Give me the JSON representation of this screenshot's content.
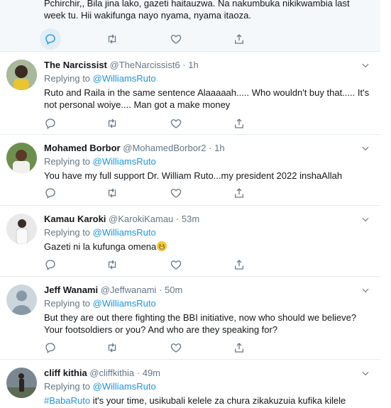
{
  "tweets": [
    {
      "text": "Pchirchir,, Bila jina lako, gazeti haitauzwa. Na nakumbuka nikikwambia last week tu. Hii wakifunga nayo nyama, nyama itaoza."
    },
    {
      "name": "The Narcissist",
      "handle": "@TheNarcissist6",
      "dot": "·",
      "time": "1h",
      "replying_prefix": "Replying to",
      "replying_to": "@WilliamsRuto",
      "text": "Ruto and Raila in the same sentence Alaaaaah..... Who wouldn't buy that..... It's not personal woiye.... Man got a make money"
    },
    {
      "name": "Mohamed Borbor",
      "handle": "@MohamedBorbor2",
      "dot": "·",
      "time": "1h",
      "replying_prefix": "Replying to",
      "replying_to": "@WilliamsRuto",
      "text": "You have my full support Dr. William Ruto...my president 2022 inshaAllah"
    },
    {
      "name": "Kamau Karoki",
      "handle": "@KarokiKamau",
      "dot": "·",
      "time": "53m",
      "replying_prefix": "Replying to",
      "replying_to": "@WilliamsRuto",
      "text": "Gazeti ni la kufunga omena"
    },
    {
      "name": "Jeff Wanami",
      "handle": "@Jeffwanami",
      "dot": "·",
      "time": "50m",
      "replying_prefix": "Replying to",
      "replying_to": "@WilliamsRuto",
      "text": "But they are out there fighting the BBI initiative, now who should we believe? Your footsoldiers or you? And who are they speaking for?"
    },
    {
      "name": "cliff kithia",
      "handle": "@cliffkithia",
      "dot": "·",
      "time": "49m",
      "replying_prefix": "Replying to",
      "replying_to": "@WilliamsRuto",
      "hashtag": "#BabaRuto",
      "text": " it's your time, usikubali kelele za chura zikakuzuia kufika kilele"
    }
  ],
  "icons": {
    "reply": "reply-icon",
    "retweet": "retweet-icon",
    "like": "like-icon",
    "share": "share-icon",
    "menu": "chevron-down-icon"
  },
  "colors": {
    "accent": "#1b95e0",
    "muted": "#657786",
    "text": "#14171a",
    "border": "#e6ecf0",
    "highlight_bg": "#f5f8fa"
  }
}
